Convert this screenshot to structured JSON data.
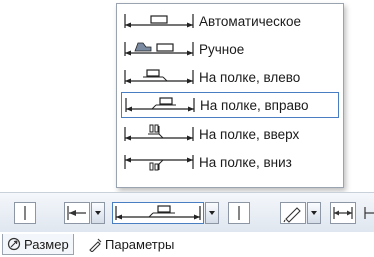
{
  "dimension_style_menu": {
    "items": [
      {
        "label": "Автоматическое",
        "icon": "dimension-auto-icon"
      },
      {
        "label": "Ручное",
        "icon": "dimension-manual-icon"
      },
      {
        "label": "На полке, влево",
        "icon": "dimension-shelf-left-icon"
      },
      {
        "label": "На полке, вправо",
        "icon": "dimension-shelf-right-icon"
      },
      {
        "label": "На полке, вверх",
        "icon": "dimension-shelf-up-icon"
      },
      {
        "label": "На полке, вниз",
        "icon": "dimension-shelf-down-icon"
      }
    ],
    "selected_index": 3
  },
  "toolbar": {
    "icons": [
      "separator-icon",
      "arrow-in-icon",
      "dimension-shelf-right-icon",
      "separator-icon",
      "edit-text-icon",
      "arrows-outward-icon"
    ]
  },
  "tabs": {
    "items": [
      {
        "label": "Размер",
        "icon": "dimension-tab-icon"
      },
      {
        "label": "Параметры",
        "icon": "parameters-tab-icon"
      }
    ],
    "active_index": 0
  },
  "colors": {
    "selection_border": "#4a7ec3",
    "popup_border": "#9aa3b0",
    "toolbar_bg": "#dfe6ef"
  }
}
